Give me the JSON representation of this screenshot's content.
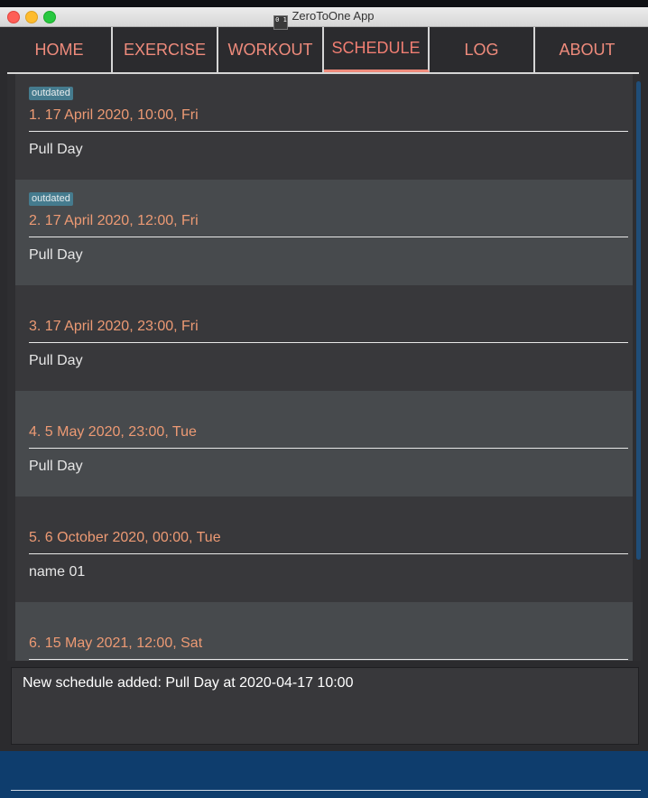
{
  "window": {
    "title": "ZeroToOne App",
    "icon_label": "0 1"
  },
  "tabs": [
    {
      "label": "HOME"
    },
    {
      "label": "EXERCISE"
    },
    {
      "label": "WORKOUT"
    },
    {
      "label": "SCHEDULE",
      "active": true
    },
    {
      "label": "LOG"
    },
    {
      "label": "ABOUT"
    }
  ],
  "schedules": [
    {
      "badge": "outdated",
      "title": "1.  17 April 2020, 10:00, Fri",
      "name": "Pull Day"
    },
    {
      "badge": "outdated",
      "title": "2.  17 April 2020, 12:00, Fri",
      "name": "Pull Day"
    },
    {
      "badge": "",
      "title": "3.  17 April 2020, 23:00, Fri",
      "name": "Pull Day"
    },
    {
      "badge": "",
      "title": "4.  5 May 2020, 23:00, Tue",
      "name": "Pull Day"
    },
    {
      "badge": "",
      "title": "5.  6 October 2020, 00:00, Tue",
      "name": "name 01"
    },
    {
      "badge": "",
      "title": "6.  15 May 2021, 12:00, Sat",
      "name": ""
    }
  ],
  "result": {
    "message": "New schedule added: Pull Day at 2020-04-17 10:00"
  },
  "command": {
    "value": "",
    "placeholder": ""
  },
  "colors": {
    "accent": "#ef8b7c",
    "schedule_title": "#ed9a74",
    "badge": "#457b8e",
    "command_bar": "#0e3d6d"
  }
}
